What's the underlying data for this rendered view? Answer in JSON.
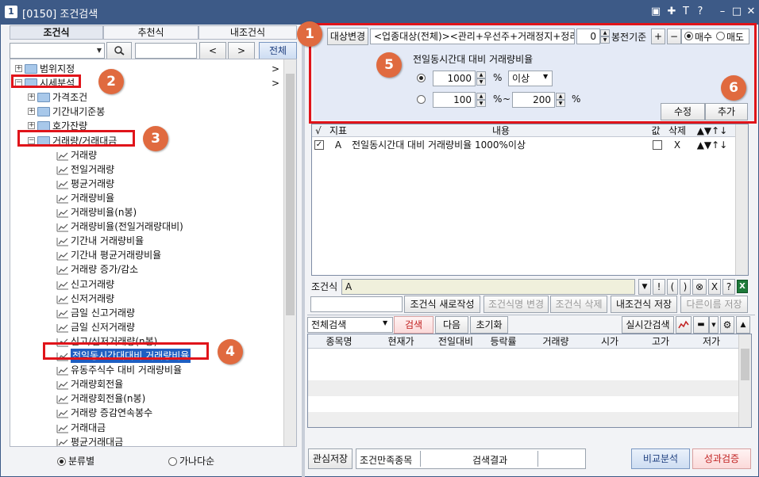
{
  "window": {
    "code": "[0150]",
    "title": "조건검색",
    "app_icon": "1",
    "controls": [
      "▣",
      "✚",
      "T",
      "?",
      "–",
      "□",
      "✕"
    ]
  },
  "left": {
    "tabs": [
      "조건식",
      "추천식",
      "내조건식"
    ],
    "search": {
      "value": "",
      "prev": "<",
      "next": ">",
      "all": "전체"
    },
    "tree": [
      {
        "label": "범위지정",
        "level": 0,
        "type": "folder",
        "expand": "+",
        "arrow": ">"
      },
      {
        "label": "시세분석",
        "level": 0,
        "type": "folder",
        "expand": "−",
        "arrow": ">"
      },
      {
        "label": "가격조건",
        "level": 1,
        "type": "folder",
        "expand": "+"
      },
      {
        "label": "기간내기준봉",
        "level": 1,
        "type": "folder",
        "expand": "+"
      },
      {
        "label": "호가잔량",
        "level": 1,
        "type": "folder",
        "expand": "+"
      },
      {
        "label": "거래량/거래대금",
        "level": 1,
        "type": "folder",
        "expand": "−"
      },
      {
        "label": "거래량",
        "level": 2,
        "type": "leaf"
      },
      {
        "label": "전일거래량",
        "level": 2,
        "type": "leaf"
      },
      {
        "label": "평균거래량",
        "level": 2,
        "type": "leaf"
      },
      {
        "label": "거래량비율",
        "level": 2,
        "type": "leaf"
      },
      {
        "label": "거래량비율(n봉)",
        "level": 2,
        "type": "leaf"
      },
      {
        "label": "거래량비율(전일거래량대비)",
        "level": 2,
        "type": "leaf"
      },
      {
        "label": "기간내 거래량비율",
        "level": 2,
        "type": "leaf"
      },
      {
        "label": "기간내 평균거래량비율",
        "level": 2,
        "type": "leaf"
      },
      {
        "label": "거래량 증가/감소",
        "level": 2,
        "type": "leaf"
      },
      {
        "label": "신고거래량",
        "level": 2,
        "type": "leaf"
      },
      {
        "label": "신저거래량",
        "level": 2,
        "type": "leaf"
      },
      {
        "label": "금일 신고거래량",
        "level": 2,
        "type": "leaf"
      },
      {
        "label": "금일 신저거래량",
        "level": 2,
        "type": "leaf"
      },
      {
        "label": "신고/신저거래량(n봉)",
        "level": 2,
        "type": "leaf"
      },
      {
        "label": "전일동시간대대비 거래량비율",
        "level": 2,
        "type": "leaf",
        "selected": true
      },
      {
        "label": "유동주식수 대비 거래량비율",
        "level": 2,
        "type": "leaf"
      },
      {
        "label": "거래량회전율",
        "level": 2,
        "type": "leaf"
      },
      {
        "label": "거래량회전율(n봉)",
        "level": 2,
        "type": "leaf"
      },
      {
        "label": "거래량 증감연속봉수",
        "level": 2,
        "type": "leaf"
      },
      {
        "label": "거래대금",
        "level": 2,
        "type": "leaf"
      },
      {
        "label": "평균거래대금",
        "level": 2,
        "type": "leaf"
      }
    ],
    "sort": {
      "option1": "분류별",
      "option2": "가나다순"
    }
  },
  "condition": {
    "target_button": "대상변경",
    "target_text": "<업종대상(전체)><관리+우선주+거래정지+정리매매",
    "bar_value": "0",
    "bar_label": "봉전기준",
    "plus": "+",
    "minus": "−",
    "buy": "매수",
    "sell": "매도",
    "name": "전일동시간대 대비 거래량비율",
    "row1": {
      "value": "1000",
      "unit": "%",
      "op": "이상"
    },
    "row2": {
      "from": "100",
      "unit1": "%",
      "tilde": "~",
      "to": "200",
      "unit2": "%"
    },
    "modify": "수정",
    "add": "추가"
  },
  "cond_table": {
    "headers": [
      "√",
      "지표",
      "내용",
      "값",
      "삭제",
      "▲▼↑↓"
    ],
    "rows": [
      {
        "index": "A",
        "content": "전일동시간대 대비 거래량비율 1000%이상",
        "delete": "X",
        "moves": "▲▼↑↓"
      }
    ]
  },
  "formula": {
    "label": "조건식",
    "value": "A",
    "ops": [
      "▼",
      "!",
      "(",
      ")",
      "⊗",
      "X",
      "?"
    ],
    "new_btn": "조건식 새로작성",
    "rename_btn": "조건식명 변경",
    "delete_btn": "조건식 삭제",
    "save_btn": "내조건식 저장",
    "saveas_btn": "다른이름 저장"
  },
  "search": {
    "scope": "전체검색",
    "search_btn": "검색",
    "next_btn": "다음",
    "reset_btn": "초기화",
    "realtime_btn": "실시간검색"
  },
  "results": {
    "headers": [
      "종목명",
      "현재가",
      "전일대비",
      "등락률",
      "거래량",
      "시가",
      "고가",
      "저가"
    ]
  },
  "footer": {
    "save_btn": "관심저장",
    "count_label": "조건만족종목",
    "result_label": "검색결과",
    "compare_btn": "비교분석",
    "perf_btn": "성과검증"
  },
  "annotations": [
    "1",
    "2",
    "3",
    "4",
    "5",
    "6"
  ],
  "colors": {
    "titlebar": "#3d5a87",
    "highlight": "#e0141a",
    "badge": "#e06a3f",
    "condition_panel": "#e4eaf6"
  }
}
